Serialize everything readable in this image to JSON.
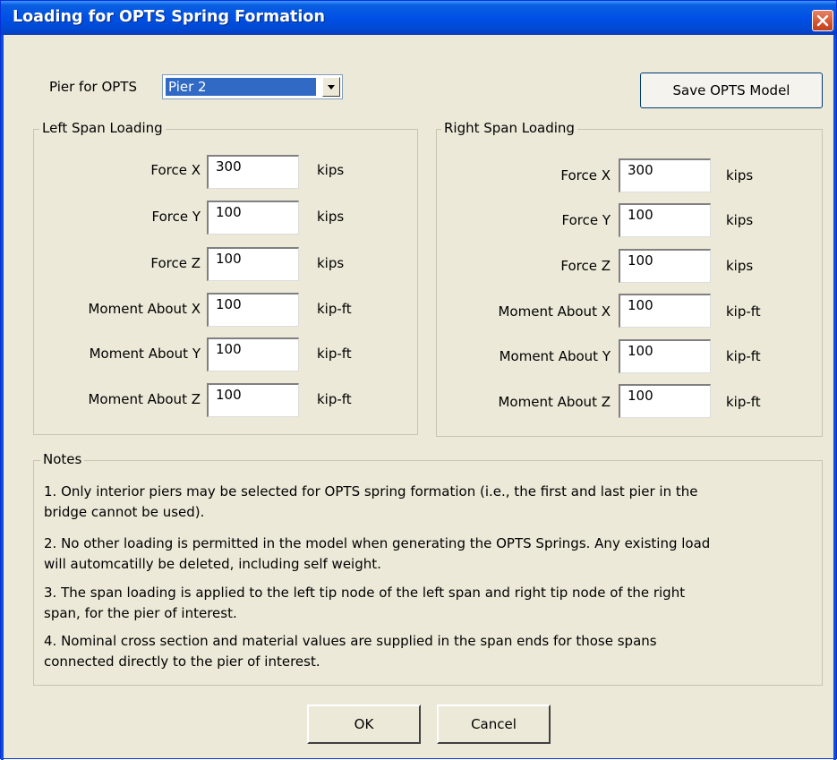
{
  "window": {
    "title": "Loading for OPTS Spring Formation"
  },
  "pier": {
    "label": "Pier for OPTS",
    "selected": "Pier 2"
  },
  "save_button": "Save OPTS Model",
  "left_span": {
    "title": "Left Span Loading",
    "rows": [
      {
        "label": "Force X",
        "value": "300",
        "unit": "kips"
      },
      {
        "label": "Force Y",
        "value": "100",
        "unit": "kips"
      },
      {
        "label": "Force Z",
        "value": "100",
        "unit": "kips"
      },
      {
        "label": "Moment About X",
        "value": "100",
        "unit": "kip-ft"
      },
      {
        "label": "Moment About Y",
        "value": "100",
        "unit": "kip-ft"
      },
      {
        "label": "Moment About Z",
        "value": "100",
        "unit": "kip-ft"
      }
    ]
  },
  "right_span": {
    "title": "Right Span Loading",
    "rows": [
      {
        "label": "Force X",
        "value": "300",
        "unit": "kips"
      },
      {
        "label": "Force Y",
        "value": "100",
        "unit": "kips"
      },
      {
        "label": "Force Z",
        "value": "100",
        "unit": "kips"
      },
      {
        "label": "Moment About X",
        "value": "100",
        "unit": "kip-ft"
      },
      {
        "label": "Moment About Y",
        "value": "100",
        "unit": "kip-ft"
      },
      {
        "label": "Moment About Z",
        "value": "100",
        "unit": "kip-ft"
      }
    ]
  },
  "notes": {
    "title": "Notes",
    "items": [
      {
        "line1": "1. Only interior piers may be selected for OPTS spring formation (i.e., the first and last pier in the",
        "line2": "bridge cannot be used)."
      },
      {
        "line1": "2.  No other loading is permitted in the model when generating the OPTS Springs.  Any existing load",
        "line2": "will automcatilly be deleted, including self weight."
      },
      {
        "line1": "3. The span loading is applied to the left tip node of the left span and right tip node of the right",
        "line2": "span, for the pier of interest."
      },
      {
        "line1": "4. Nominal cross section and material values are supplied in the span ends for those spans",
        "line2": "connected directly to the pier of interest."
      }
    ]
  },
  "buttons": {
    "ok": "OK",
    "cancel": "Cancel"
  }
}
